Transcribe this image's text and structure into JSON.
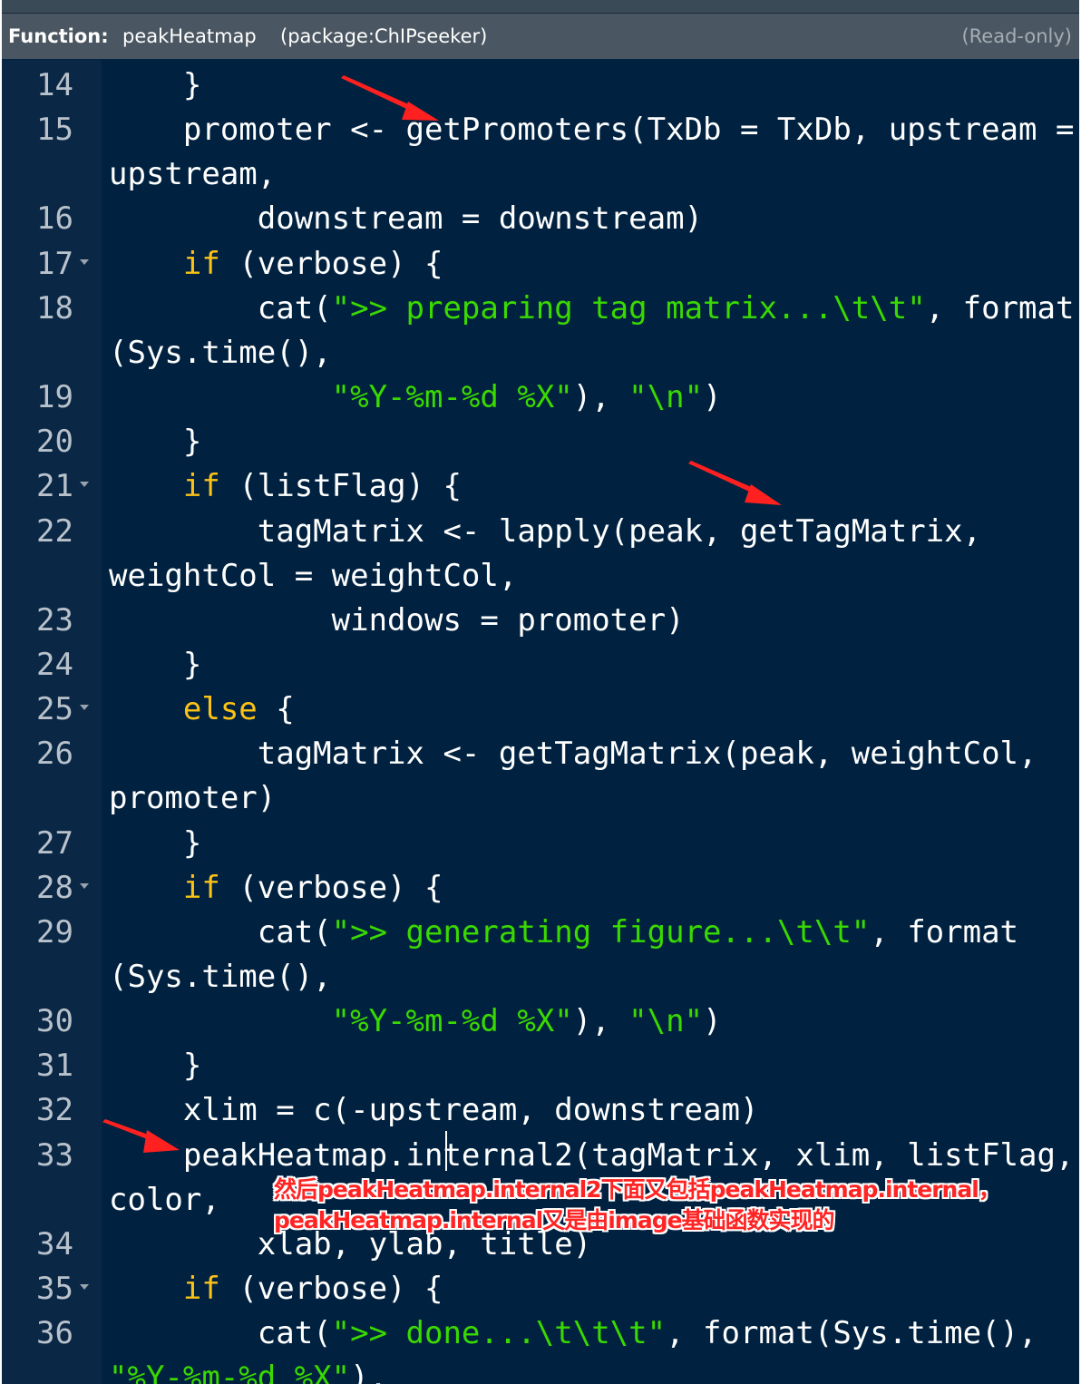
{
  "header": {
    "function_label": "Function:",
    "function_name": "peakHeatmap",
    "package": "(package:ChIPseeker)",
    "status": "(Read-only)"
  },
  "lines": [
    {
      "num": "14",
      "fold": false,
      "code": "    }"
    },
    {
      "num": "15",
      "fold": false,
      "code": "    promoter <- getPromoters(TxDb = TxDb, upstream ="
    },
    {
      "num": "",
      "fold": false,
      "code": "upstream,"
    },
    {
      "num": "16",
      "fold": false,
      "code": "        downstream = downstream)"
    },
    {
      "num": "17",
      "fold": true,
      "code": "    if (verbose) {"
    },
    {
      "num": "18",
      "fold": false,
      "code": "        cat(\">> preparing tag matrix...\\t\\t\", format"
    },
    {
      "num": "",
      "fold": false,
      "code": "(Sys.time(),"
    },
    {
      "num": "19",
      "fold": false,
      "code": "            \"%Y-%m-%d %X\"), \"\\n\")"
    },
    {
      "num": "20",
      "fold": false,
      "code": "    }"
    },
    {
      "num": "21",
      "fold": true,
      "code": "    if (listFlag) {"
    },
    {
      "num": "22",
      "fold": false,
      "code": "        tagMatrix <- lapply(peak, getTagMatrix,"
    },
    {
      "num": "",
      "fold": false,
      "code": "weightCol = weightCol,"
    },
    {
      "num": "23",
      "fold": false,
      "code": "            windows = promoter)"
    },
    {
      "num": "24",
      "fold": false,
      "code": "    }"
    },
    {
      "num": "25",
      "fold": true,
      "code": "    else {"
    },
    {
      "num": "26",
      "fold": false,
      "code": "        tagMatrix <- getTagMatrix(peak, weightCol,"
    },
    {
      "num": "",
      "fold": false,
      "code": "promoter)"
    },
    {
      "num": "27",
      "fold": false,
      "code": "    }"
    },
    {
      "num": "28",
      "fold": true,
      "code": "    if (verbose) {"
    },
    {
      "num": "29",
      "fold": false,
      "code": "        cat(\">> generating figure...\\t\\t\", format"
    },
    {
      "num": "",
      "fold": false,
      "code": "(Sys.time(),"
    },
    {
      "num": "30",
      "fold": false,
      "code": "            \"%Y-%m-%d %X\"), \"\\n\")"
    },
    {
      "num": "31",
      "fold": false,
      "code": "    }"
    },
    {
      "num": "32",
      "fold": false,
      "code": "    xlim = c(-upstream, downstream)"
    },
    {
      "num": "33",
      "fold": false,
      "code": "    peakHeatmap.internal2(tagMatrix, xlim, listFlag,"
    },
    {
      "num": "",
      "fold": false,
      "code": "color,"
    },
    {
      "num": "34",
      "fold": false,
      "code": "        xlab, ylab, title)"
    },
    {
      "num": "35",
      "fold": true,
      "code": "    if (verbose) {"
    },
    {
      "num": "36",
      "fold": false,
      "code": "        cat(\">> done...\\t\\t\\t\", format(Sys.time(),"
    },
    {
      "num": "",
      "fold": false,
      "code": "\"%Y-%m-%d %X\"),"
    }
  ],
  "annotation": {
    "line1": "然后peakHeatmap.internal2下面又包括peakHeatmap.internal，",
    "line2": "peakHeatmap.internal又是由image基础函数实现的"
  },
  "colors": {
    "background": "#002240",
    "keyword": "#fcc216",
    "string": "#3ad900",
    "annotation": "#ff2424"
  }
}
